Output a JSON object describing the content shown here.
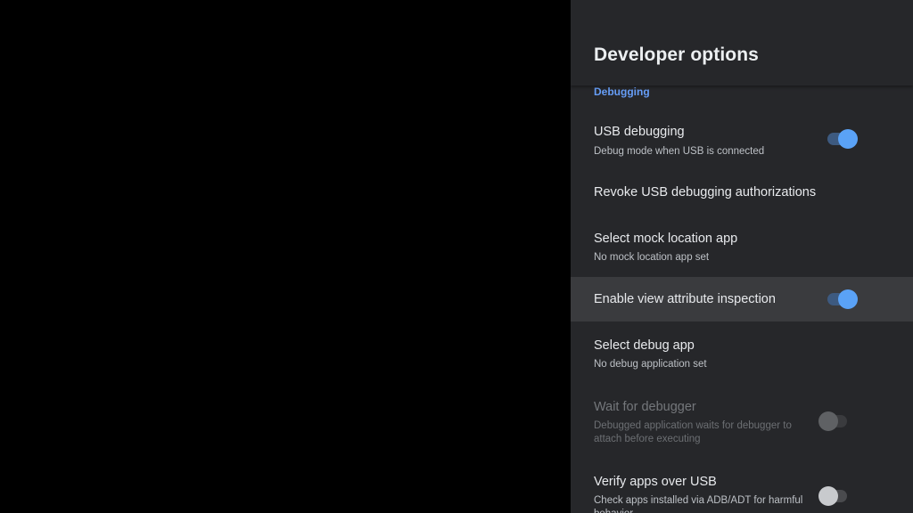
{
  "panel": {
    "title": "Developer options",
    "section": "Debugging"
  },
  "prefs": [
    {
      "title": "USB debugging",
      "summary": "Debug mode when USB is connected",
      "toggle": "on"
    },
    {
      "title": "Revoke USB debugging authorizations"
    },
    {
      "title": "Select mock location app",
      "summary": "No mock location app set"
    },
    {
      "title": "Enable view attribute inspection",
      "toggle": "on",
      "focused": true
    },
    {
      "title": "Select debug app",
      "summary": "No debug application set"
    },
    {
      "title": "Wait for debugger",
      "summary": "Debugged application waits for debugger to attach before executing",
      "toggle": "off",
      "disabled": true
    },
    {
      "title": "Verify apps over USB",
      "summary": "Check apps installed via ADB/ADT for harmful behavior.",
      "toggle": "off"
    }
  ],
  "colors": {
    "accent": "#669df6",
    "panel_bg": "#26272a",
    "focus_bg": "#3a3b3e",
    "toggle_on": "#5aa2f6"
  }
}
